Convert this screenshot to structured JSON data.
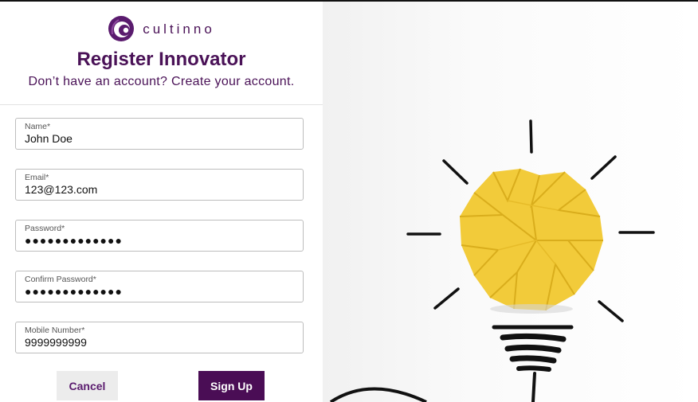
{
  "brand": {
    "name": "cultinno",
    "logo_icon": "cultinno-swirl-icon",
    "color": "#4a1257"
  },
  "header": {
    "title": "Register Innovator",
    "subtitle": "Don’t have an account? Create your account."
  },
  "form": {
    "name": {
      "label": "Name*",
      "value": "John Doe"
    },
    "email": {
      "label": "Email*",
      "value": "123@123.com"
    },
    "password": {
      "label": "Password*",
      "value": "●●●●●●●●●●●●●"
    },
    "confirm_password": {
      "label": "Confirm Password*",
      "value": "●●●●●●●●●●●●●"
    },
    "mobile": {
      "label": "Mobile Number*",
      "value": "9999999999"
    }
  },
  "actions": {
    "cancel_label": "Cancel",
    "signup_label": "Sign Up",
    "signup_color": "#4a0d55"
  },
  "illustration": {
    "icon": "crumpled-paper-lightbulb-icon",
    "paper_color": "#f2cb3a"
  }
}
